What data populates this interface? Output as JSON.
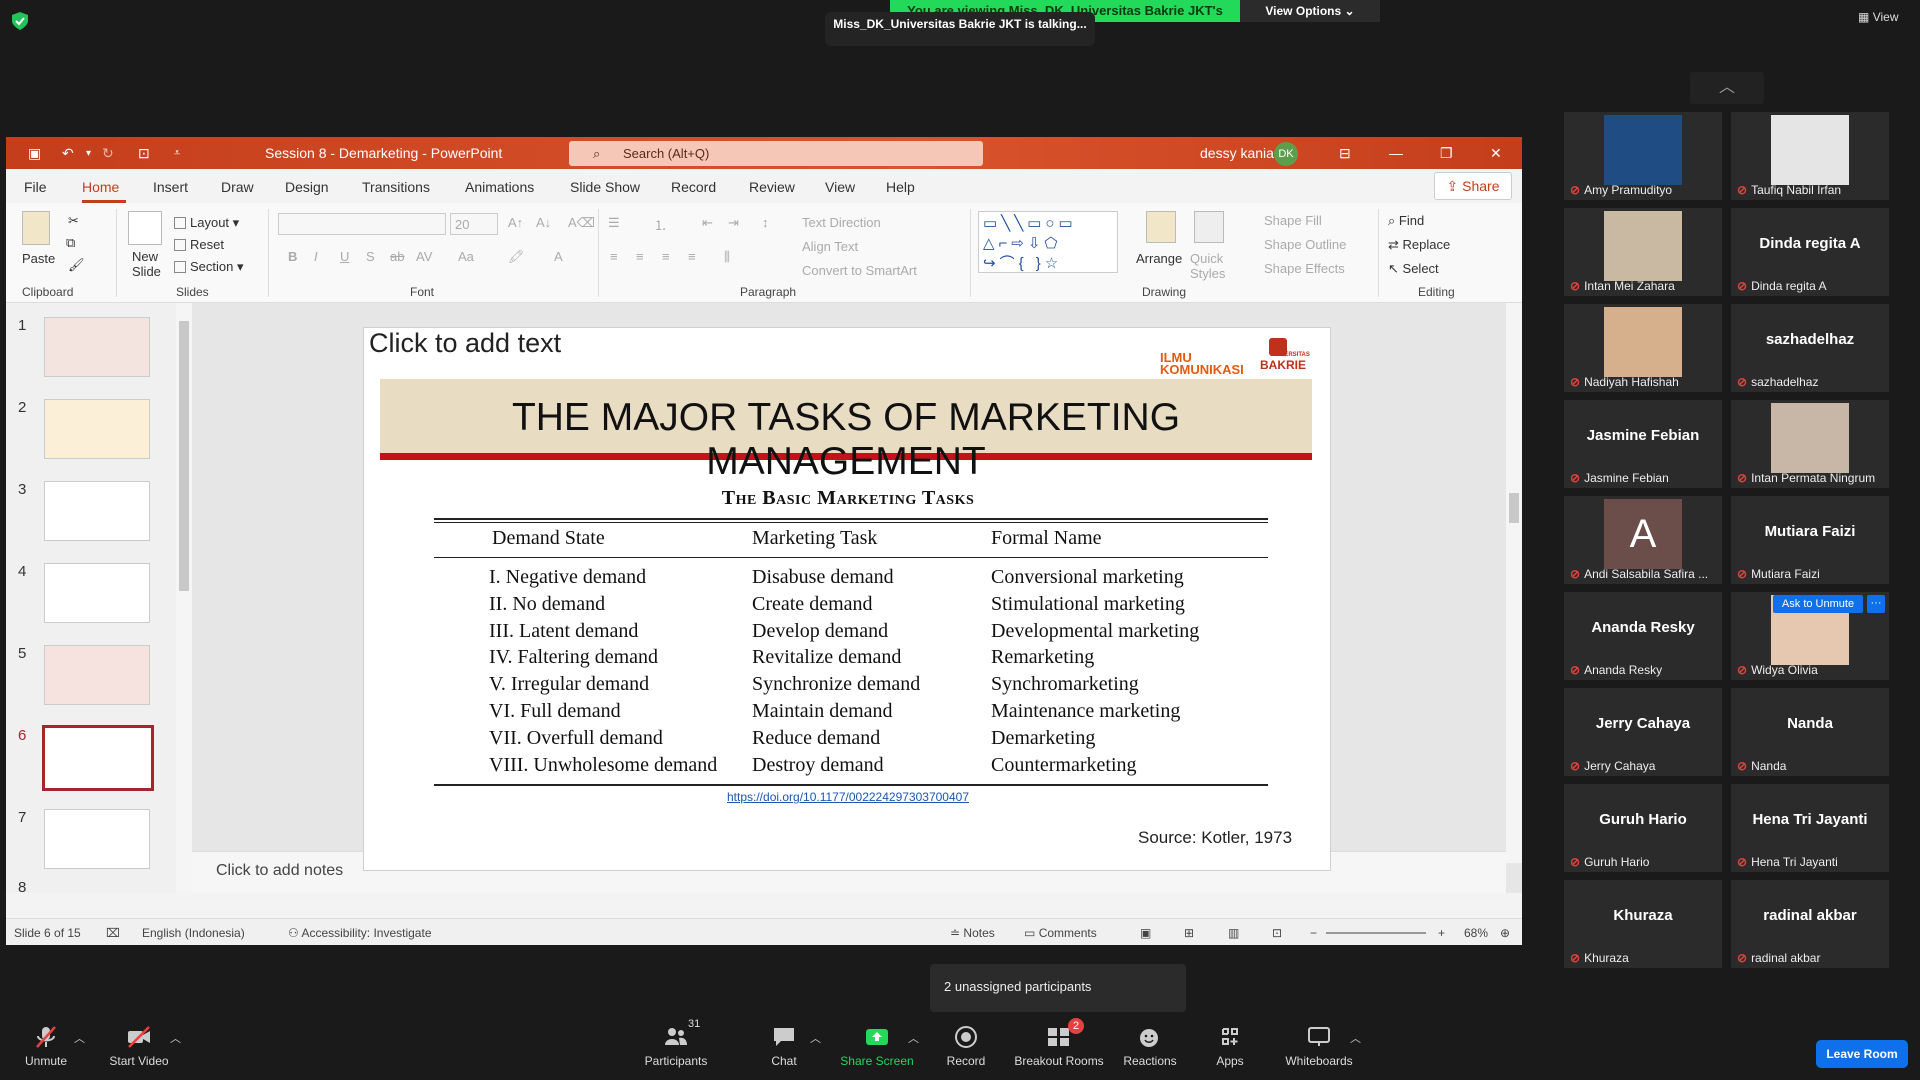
{
  "zoom": {
    "share_banner": "You are viewing Miss_DK_Universitas Bakrie JKT's screen",
    "view_options": "View Options",
    "talking": "Miss_DK_Universitas Bakrie JKT is talking...",
    "view_button": "View",
    "unassigned": "2 unassigned participants",
    "leave_room": "Leave Room"
  },
  "powerpoint": {
    "doc_title": "Session 8 - Demarketing  -  PowerPoint",
    "search_placeholder": "Search (Alt+Q)",
    "user_name": "dessy kania",
    "user_initials": "DK",
    "menu_tabs": [
      "File",
      "Home",
      "Insert",
      "Draw",
      "Design",
      "Transitions",
      "Animations",
      "Slide Show",
      "Record",
      "Review",
      "View",
      "Help"
    ],
    "share": "Share",
    "ribbon": {
      "paste": "Paste",
      "new_slide": "New Slide",
      "layout": "Layout",
      "reset": "Reset",
      "section": "Section",
      "font_size": "20",
      "text_direction": "Text Direction",
      "align_text": "Align Text",
      "convert_smartart": "Convert to SmartArt",
      "arrange": "Arrange",
      "quick_styles": "Quick Styles",
      "shape_fill": "Shape Fill",
      "shape_outline": "Shape Outline",
      "shape_effects": "Shape Effects",
      "find": "Find",
      "replace": "Replace",
      "select": "Select",
      "groups": [
        "Clipboard",
        "Slides",
        "Font",
        "Paragraph",
        "Drawing",
        "Editing"
      ]
    },
    "thumb_numbers": [
      "1",
      "2",
      "3",
      "4",
      "5",
      "6",
      "7",
      "8"
    ],
    "slide": {
      "placeholder": "Click to add text",
      "logo_line1": "ILMU",
      "logo_line2": "KOMUNIKASI",
      "logo_brand": "BAKRIE",
      "logo_brand_top": "UNIVERSITAS",
      "title": "THE MAJOR TASKS OF MARKETING MANAGEMENT",
      "table_heading": "The Basic Marketing Tasks",
      "table_headers": [
        "Demand State",
        "Marketing Task",
        "Formal Name"
      ],
      "table_rows": [
        [
          "I. Negative demand",
          "Disabuse demand",
          "Conversional marketing"
        ],
        [
          "II. No demand",
          "Create demand",
          "Stimulational marketing"
        ],
        [
          "III. Latent demand",
          "Develop demand",
          "Developmental marketing"
        ],
        [
          "IV. Faltering demand",
          "Revitalize demand",
          "Remarketing"
        ],
        [
          "V. Irregular demand",
          "Synchronize demand",
          "Synchromarketing"
        ],
        [
          "VI. Full demand",
          "Maintain demand",
          "Maintenance marketing"
        ],
        [
          "VII. Overfull demand",
          "Reduce demand",
          "Demarketing"
        ],
        [
          "VIII. Unwholesome demand",
          "Destroy demand",
          "Countermarketing"
        ]
      ],
      "doi": "https://doi.org/10.1177/002224297303700407",
      "source": "Source: Kotler, 1973"
    },
    "notes_placeholder": "Click to add notes",
    "status": {
      "slide_count": "Slide 6 of 15",
      "language": "English (Indonesia)",
      "accessibility": "Accessibility: Investigate",
      "notes": "Notes",
      "comments": "Comments",
      "zoom": "68%"
    }
  },
  "participants": [
    {
      "name": "Amy Pramudityo",
      "big": ""
    },
    {
      "name": "Taufiq Nabil Irfan",
      "big": ""
    },
    {
      "name": "Intan Mei Zahara",
      "big": ""
    },
    {
      "name": "Dinda regita A",
      "big": "Dinda regita A"
    },
    {
      "name": "Nadiyah Hafishah",
      "big": ""
    },
    {
      "name": "sazhadelhaz",
      "big": "sazhadelhaz"
    },
    {
      "name": "Jasmine Febian",
      "big": "Jasmine Febian"
    },
    {
      "name": "Intan Permata Ningrum",
      "big": ""
    },
    {
      "name": "Andi Salsabila Safira ...",
      "big": ""
    },
    {
      "name": "Mutiara Faizi",
      "big": "Mutiara Faizi"
    },
    {
      "name": "Ananda Resky",
      "big": "Ananda Resky"
    },
    {
      "name": "Widya Olivia",
      "big": ""
    },
    {
      "name": "Jerry Cahaya",
      "big": "Jerry Cahaya"
    },
    {
      "name": "Nanda",
      "big": "Nanda"
    },
    {
      "name": "Guruh Hario",
      "big": "Guruh Hario"
    },
    {
      "name": "Hena Tri Jayanti",
      "big": "Hena Tri Jayanti"
    },
    {
      "name": "Khuraza",
      "big": "Khuraza"
    },
    {
      "name": "radinal akbar",
      "big": "radinal akbar"
    }
  ],
  "avatar_letter": "A",
  "ask_to_unmute": "Ask to Unmute",
  "toolbar": {
    "unmute": "Unmute",
    "start_video": "Start Video",
    "participants": "Participants",
    "participants_count": "31",
    "chat": "Chat",
    "share_screen": "Share Screen",
    "record": "Record",
    "breakout_rooms": "Breakout Rooms",
    "breakout_badge": "2",
    "reactions": "Reactions",
    "apps": "Apps",
    "whiteboards": "Whiteboards"
  }
}
